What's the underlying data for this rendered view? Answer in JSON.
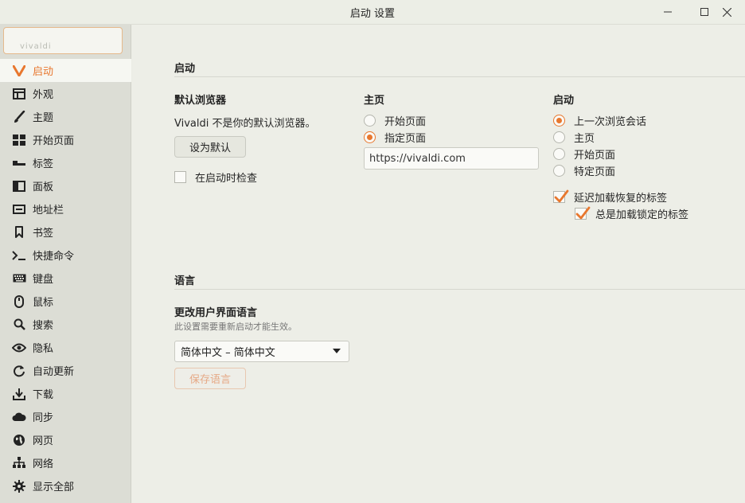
{
  "window": {
    "title": "启动 设置"
  },
  "sidebar": {
    "search_text": "vivaldi",
    "items": [
      {
        "label": "启动",
        "icon": "vivaldi-logo-icon",
        "active": true
      },
      {
        "label": "外观",
        "icon": "window-icon"
      },
      {
        "label": "主题",
        "icon": "brush-icon"
      },
      {
        "label": "开始页面",
        "icon": "grid-icon"
      },
      {
        "label": "标签",
        "icon": "tabs-icon"
      },
      {
        "label": "面板",
        "icon": "panel-icon"
      },
      {
        "label": "地址栏",
        "icon": "address-bar-icon"
      },
      {
        "label": "书签",
        "icon": "bookmark-icon"
      },
      {
        "label": "快捷命令",
        "icon": "quick-command-icon"
      },
      {
        "label": "键盘",
        "icon": "keyboard-icon"
      },
      {
        "label": "鼠标",
        "icon": "mouse-icon"
      },
      {
        "label": "搜索",
        "icon": "search-icon"
      },
      {
        "label": "隐私",
        "icon": "eye-icon"
      },
      {
        "label": "自动更新",
        "icon": "refresh-icon"
      },
      {
        "label": "下载",
        "icon": "download-icon"
      },
      {
        "label": "同步",
        "icon": "cloud-icon"
      },
      {
        "label": "网页",
        "icon": "globe-icon"
      },
      {
        "label": "网络",
        "icon": "network-icon"
      },
      {
        "label": "显示全部",
        "icon": "gear-icon"
      }
    ]
  },
  "startup": {
    "section_title": "启动",
    "default_browser": {
      "title": "默认浏览器",
      "status": "Vivaldi 不是你的默认浏览器。",
      "set_default_label": "设为默认",
      "check_on_startup_label": "在启动时检查",
      "check_on_startup": false
    },
    "homepage": {
      "title": "主页",
      "options": [
        "开始页面",
        "指定页面"
      ],
      "selected": 1,
      "url": "https://vivaldi.com"
    },
    "startup_with": {
      "title": "启动",
      "options": [
        "上一次浏览会话",
        "主页",
        "开始页面",
        "特定页面"
      ],
      "selected": 0,
      "lazy_load_label": "延迟加载恢复的标签",
      "lazy_load": true,
      "always_load_pinned_label": "总是加载锁定的标签",
      "always_load_pinned": true
    }
  },
  "language": {
    "section_title": "语言",
    "title": "更改用户界面语言",
    "hint": "此设置需要重新启动才能生效。",
    "selected_language": "简体中文 – 简体中文",
    "save_label": "保存语言"
  },
  "colors": {
    "accent": "#e8772e",
    "sidebar_bg": "#dcddd5",
    "main_bg": "#edeee7"
  }
}
